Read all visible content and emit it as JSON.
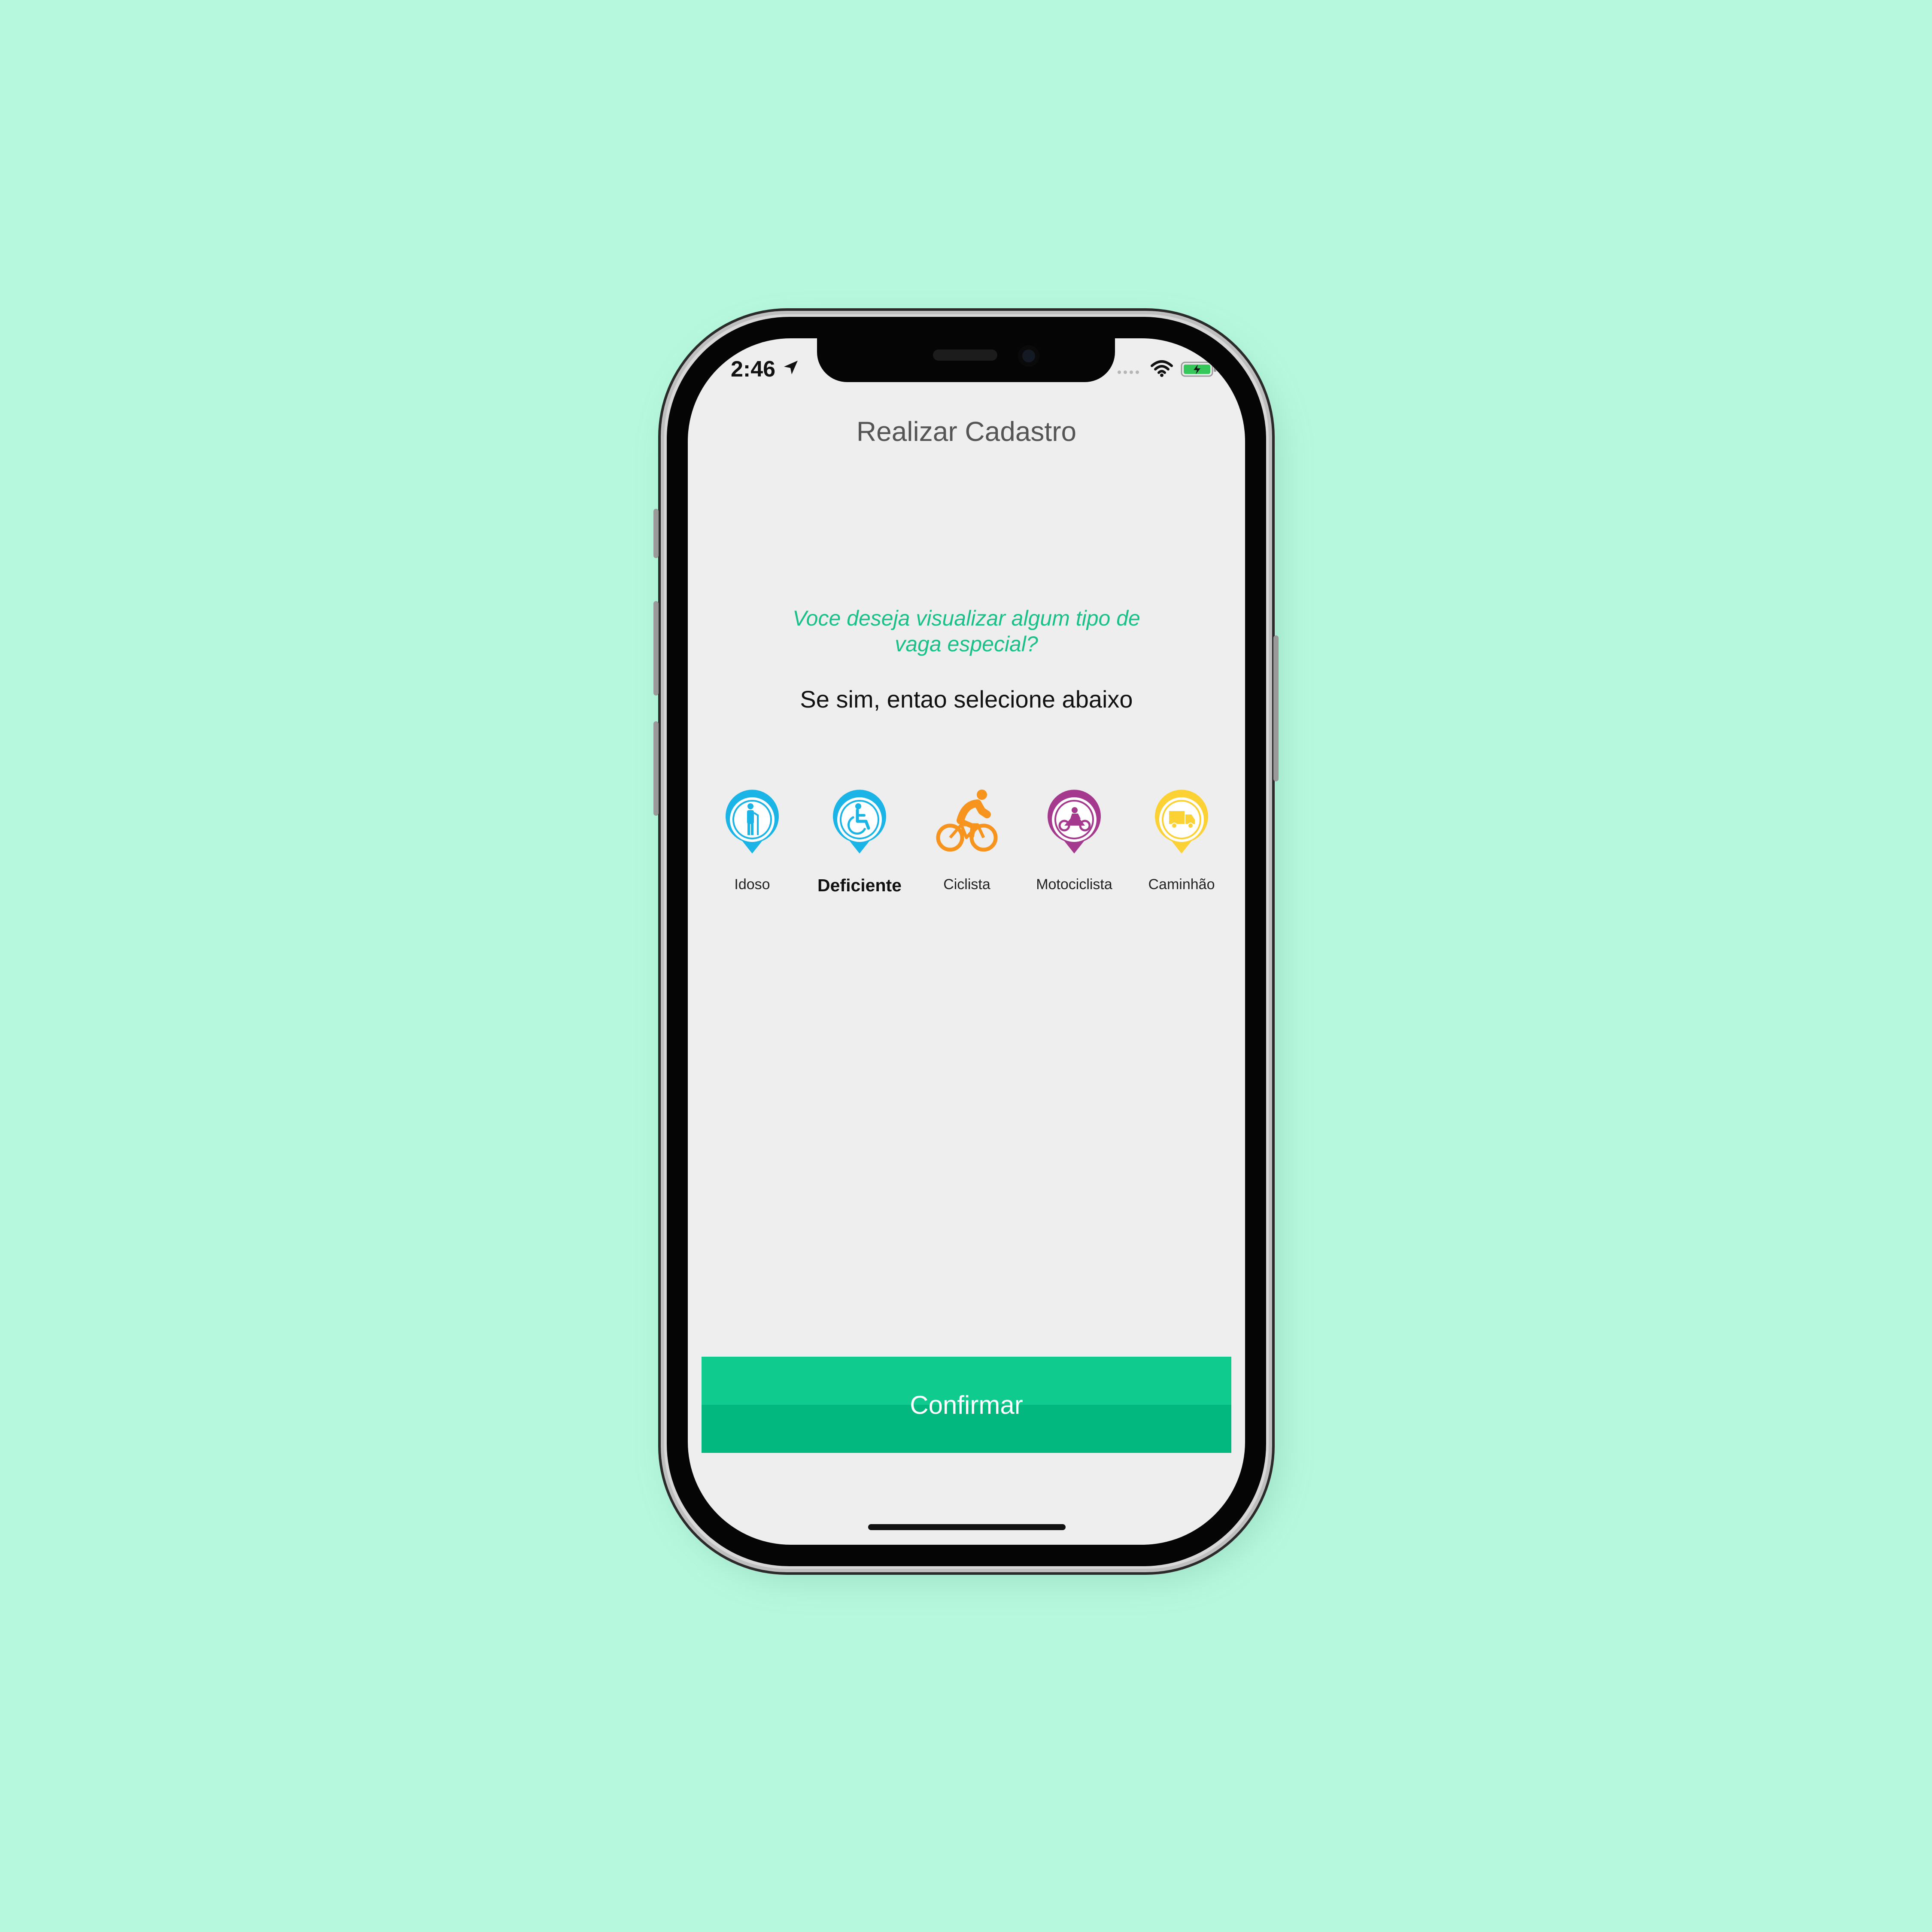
{
  "status_bar": {
    "time": "2:46",
    "icons": [
      "location-arrow-icon",
      "cellular-signal-icon",
      "wifi-icon",
      "battery-charging-icon"
    ]
  },
  "header": {
    "title": "Realizar Cadastro"
  },
  "main": {
    "question": "Voce deseja visualizar algum tipo de vaga especial?",
    "subtitle": "Se sim, entao selecione abaixo",
    "options": [
      {
        "label": "Idoso",
        "icon": "elderly-pin-icon",
        "color": "#1ab5e6",
        "selected": false
      },
      {
        "label": "Deficiente",
        "icon": "wheelchair-pin-icon",
        "color": "#1ab5e6",
        "selected": true
      },
      {
        "label": "Ciclista",
        "icon": "cyclist-icon",
        "color": "#f7941d",
        "selected": false
      },
      {
        "label": "Motociclista",
        "icon": "motorcycle-pin-icon",
        "color": "#a5398e",
        "selected": false
      },
      {
        "label": "Caminhão",
        "icon": "truck-pin-icon",
        "color": "#fcd133",
        "selected": false
      }
    ]
  },
  "footer": {
    "confirm_label": "Confirmar"
  },
  "colors": {
    "background": "#b6f8de",
    "accent": "#0fcb8d",
    "question_text": "#19c089",
    "screen": "#eeeeee"
  }
}
